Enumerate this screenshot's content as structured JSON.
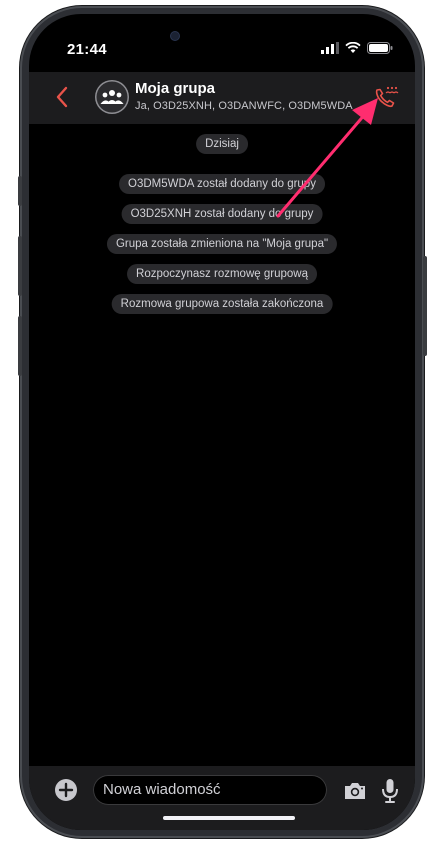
{
  "status": {
    "time": "21:44"
  },
  "header": {
    "title": "Moja grupa",
    "subtitle": "Ja, O3D25XNH, O3DANWFC, O3DM5WDA"
  },
  "chat": {
    "date_label": "Dzisiaj",
    "system_messages": [
      "O3DM5WDA został dodany do grupy",
      "O3D25XNH został dodany do grupy",
      "Grupa została zmieniona na \"Moja grupa\"",
      "Rozpoczynasz rozmowę grupową",
      "Rozmowa grupowa została zakończona"
    ]
  },
  "composer": {
    "placeholder": "Nowa wiadomość"
  },
  "colors": {
    "accent_red": "#e8534a",
    "annotation_arrow": "#ff2d6f"
  },
  "icons": [
    "back-chevron-icon",
    "group-avatar-icon",
    "group-call-icon",
    "plus-icon",
    "camera-icon",
    "microphone-icon",
    "signal-icon",
    "wifi-icon",
    "battery-icon"
  ]
}
